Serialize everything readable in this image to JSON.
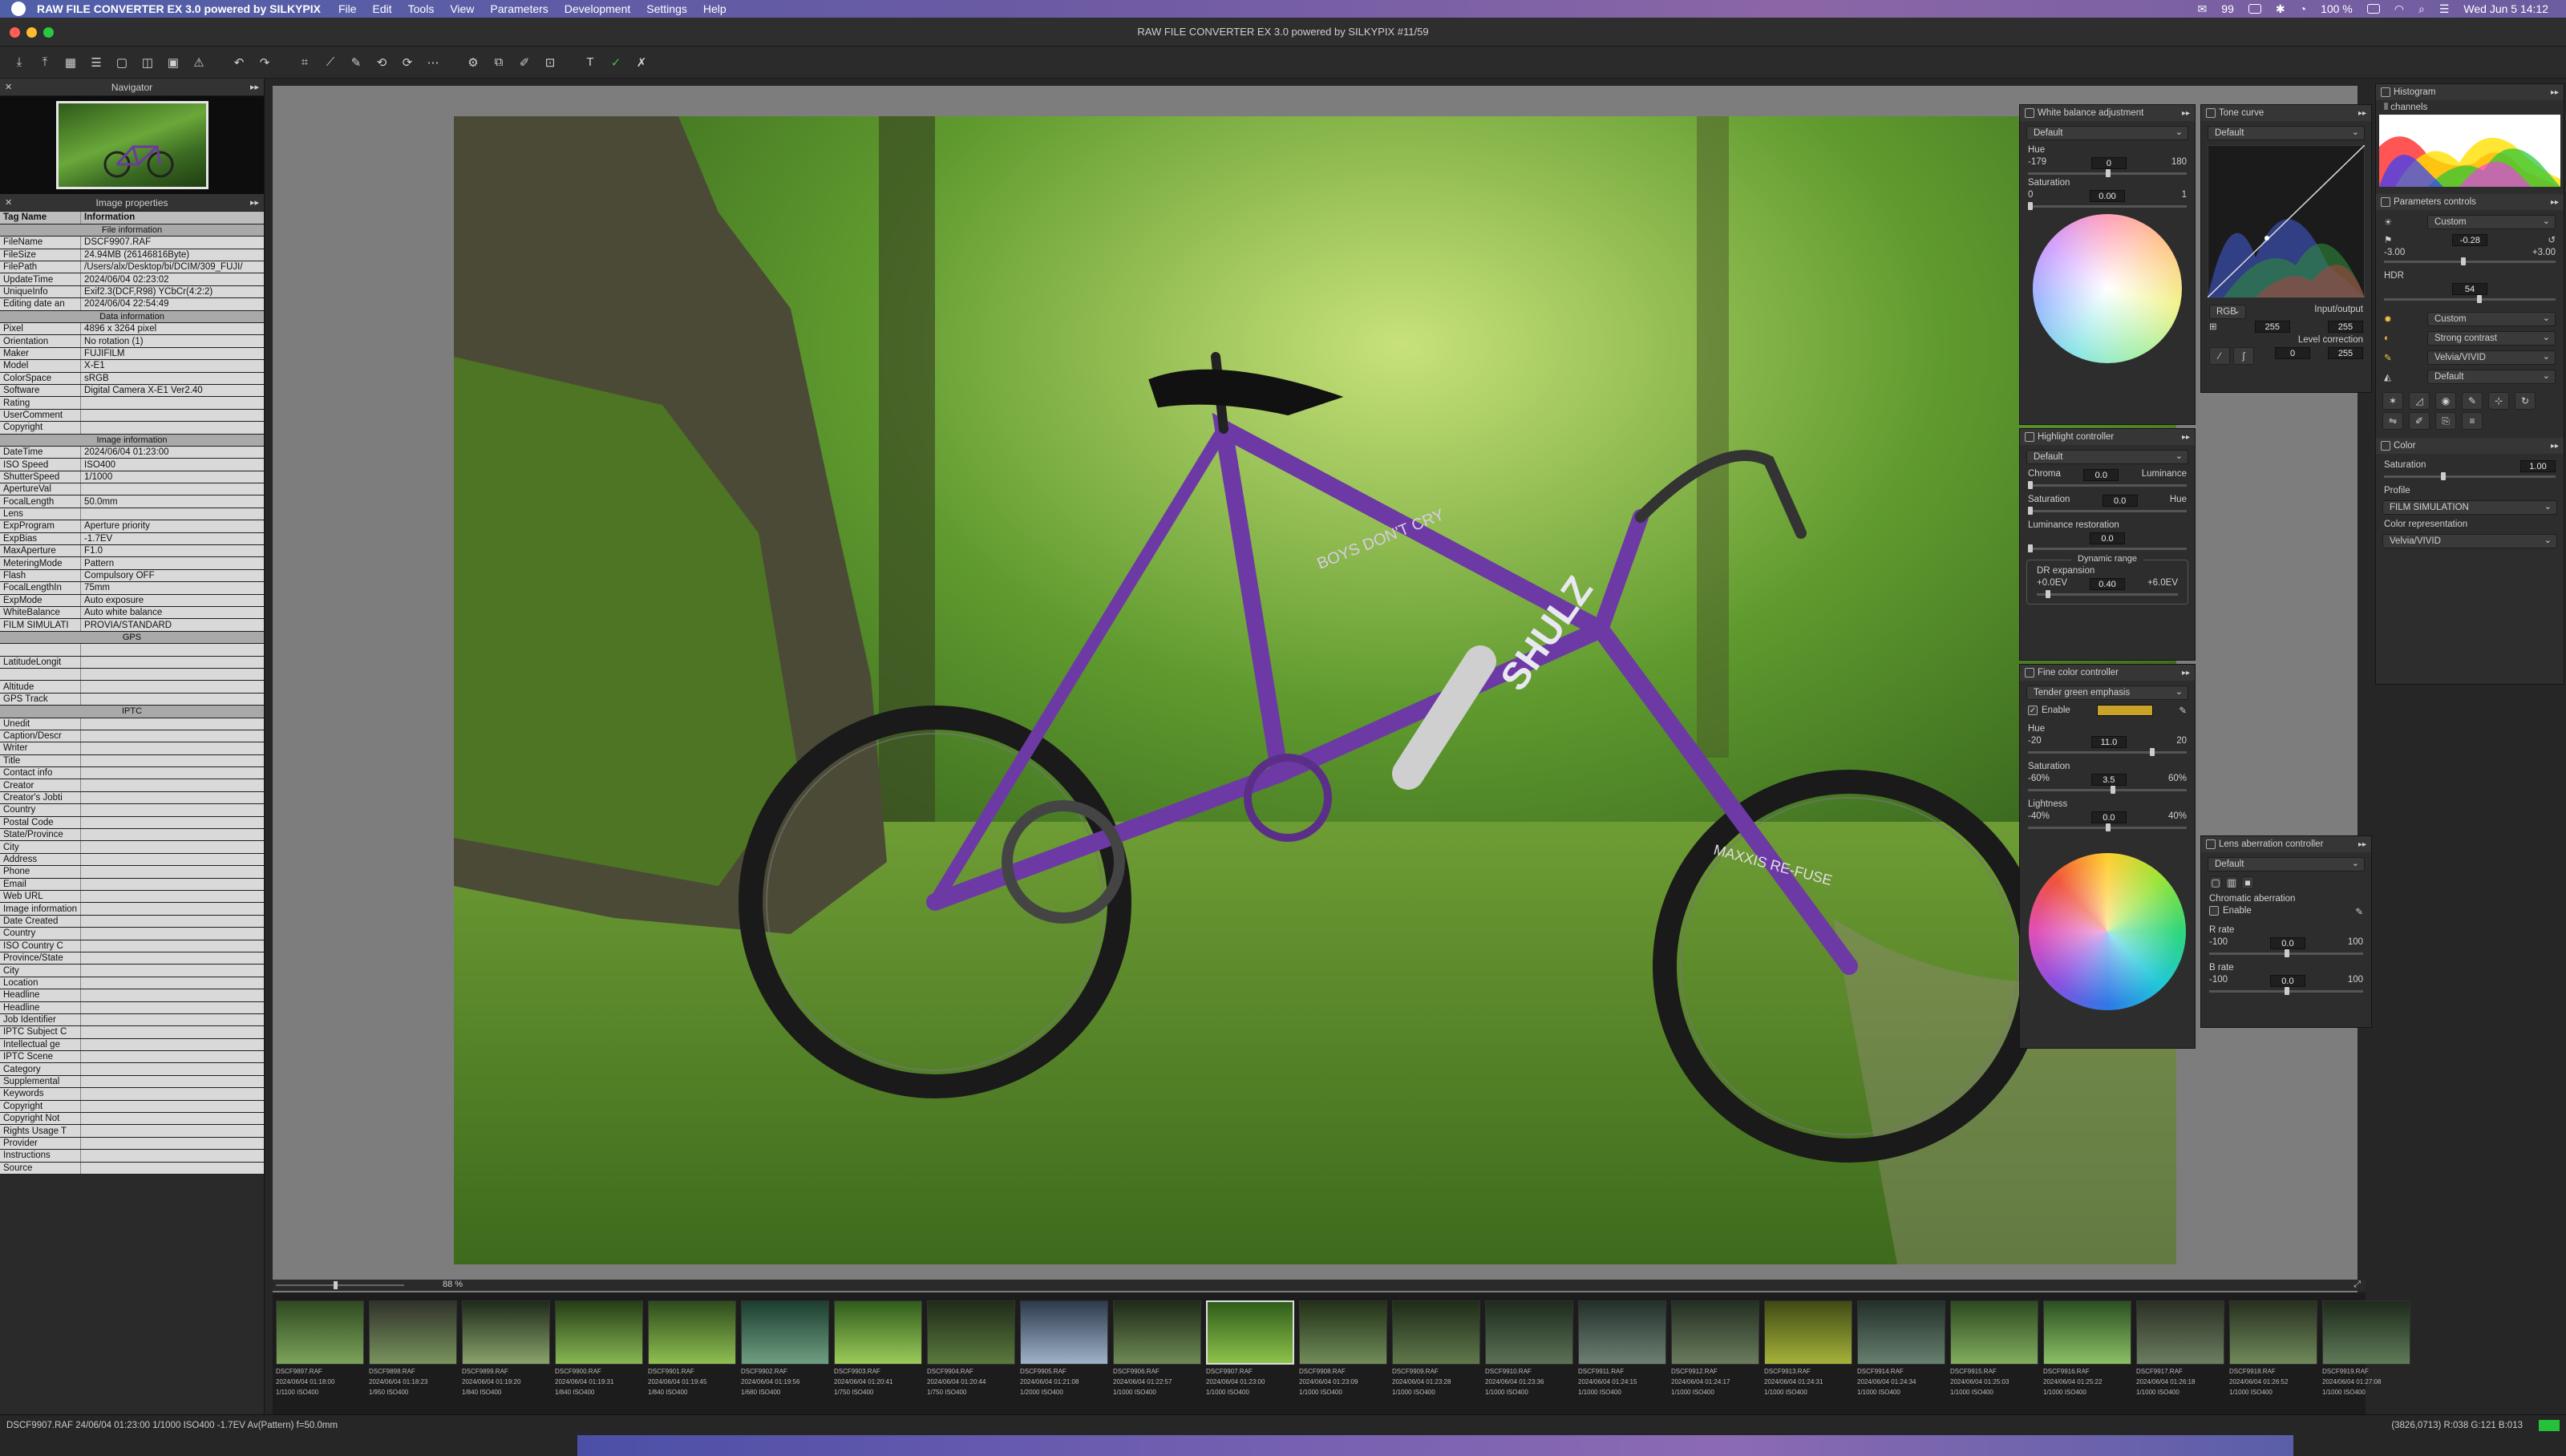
{
  "menubar": {
    "app": "RAW FILE CONVERTER EX 3.0 powered by SILKYPIX",
    "items": [
      "File",
      "Edit",
      "Tools",
      "View",
      "Parameters",
      "Development",
      "Settings",
      "Help"
    ],
    "battery": "100 %",
    "clock": "Wed Jun 5  14:12",
    "badge_count": "99"
  },
  "window": {
    "title": "RAW FILE CONVERTER EX 3.0 powered by SILKYPIX  #11/59"
  },
  "toolbar": {
    "icons": [
      "open-icon",
      "save-icon",
      "grid-view-icon",
      "list-view-icon",
      "single-view-icon",
      "compare-icon",
      "fullscreen-icon",
      "warning-icon",
      "undo-icon",
      "redo-icon",
      "crop-icon",
      "straighten-icon",
      "spot-icon",
      "rotate-left-icon",
      "rotate-right-icon",
      "dust-icon",
      "develop-icon",
      "batch-icon",
      "brush-icon",
      "overlay-icon",
      "text-icon",
      "approve-icon",
      "reject-icon"
    ]
  },
  "navigator": {
    "title": "Navigator"
  },
  "image_properties": {
    "title": "Image properties",
    "col_tag": "Tag Name",
    "col_info": "Information",
    "rows": [
      {
        "section": "File information"
      },
      {
        "k": "FileName",
        "v": "DSCF9907.RAF"
      },
      {
        "k": "FileSize",
        "v": "24.94MB (26146816Byte)"
      },
      {
        "k": "FilePath",
        "v": "/Users/alx/Desktop/bi/DCIM/309_FUJI/"
      },
      {
        "k": "UpdateTime",
        "v": "2024/06/04 02:23:02"
      },
      {
        "k": "UniqueInfo",
        "v": "Exif2.3(DCF,R98) YCbCr(4:2:2)"
      },
      {
        "k": "Editing date an",
        "v": "2024/06/04 22:54:49"
      },
      {
        "section": "Data information"
      },
      {
        "k": "Pixel",
        "v": "4896 x 3264 pixel"
      },
      {
        "k": "Orientation",
        "v": "No rotation (1)"
      },
      {
        "k": "Maker",
        "v": "FUJIFILM"
      },
      {
        "k": "Model",
        "v": "X-E1"
      },
      {
        "k": "ColorSpace",
        "v": "sRGB"
      },
      {
        "k": "Software",
        "v": "Digital Camera X-E1 Ver2.40"
      },
      {
        "k": "Rating",
        "v": ""
      },
      {
        "k": "UserComment",
        "v": ""
      },
      {
        "k": "Copyright",
        "v": ""
      },
      {
        "section": "Image information"
      },
      {
        "k": "DateTime",
        "v": "2024/06/04 01:23:00"
      },
      {
        "k": "ISO Speed",
        "v": "ISO400"
      },
      {
        "k": "ShutterSpeed",
        "v": "1/1000"
      },
      {
        "k": "ApertureVal",
        "v": ""
      },
      {
        "k": "FocalLength",
        "v": "50.0mm"
      },
      {
        "k": "Lens",
        "v": ""
      },
      {
        "k": "ExpProgram",
        "v": "Aperture priority"
      },
      {
        "k": "ExpBias",
        "v": "-1.7EV"
      },
      {
        "k": "MaxAperture",
        "v": "F1.0"
      },
      {
        "k": "MeteringMode",
        "v": "Pattern"
      },
      {
        "k": "Flash",
        "v": "Compulsory OFF"
      },
      {
        "k": "FocalLengthIn",
        "v": "75mm"
      },
      {
        "k": "ExpMode",
        "v": "Auto exposure"
      },
      {
        "k": "WhiteBalance",
        "v": "Auto white balance"
      },
      {
        "k": "FILM SIMULATI",
        "v": "PROVIA/STANDARD"
      },
      {
        "section": "GPS"
      },
      {
        "k": "",
        "v": ""
      },
      {
        "k": "LatitudeLongit",
        "v": ""
      },
      {
        "k": "",
        "v": ""
      },
      {
        "k": "Altitude",
        "v": ""
      },
      {
        "k": "GPS Track",
        "v": ""
      },
      {
        "section": "IPTC"
      },
      {
        "k": "Unedit",
        "v": ""
      },
      {
        "k": "Caption/Descr",
        "v": ""
      },
      {
        "k": "Writer",
        "v": ""
      },
      {
        "k": "Title",
        "v": ""
      },
      {
        "k": "Contact info",
        "v": ""
      },
      {
        "k": "Creator",
        "v": ""
      },
      {
        "k": "Creator's Jobti",
        "v": ""
      },
      {
        "k": "Country",
        "v": ""
      },
      {
        "k": "Postal Code",
        "v": ""
      },
      {
        "k": "State/Province",
        "v": ""
      },
      {
        "k": "City",
        "v": ""
      },
      {
        "k": "Address",
        "v": ""
      },
      {
        "k": "Phone",
        "v": ""
      },
      {
        "k": "Email",
        "v": ""
      },
      {
        "k": "Web URL",
        "v": ""
      },
      {
        "k": "Image information",
        "v": ""
      },
      {
        "k": "Date Created",
        "v": ""
      },
      {
        "k": "Country",
        "v": ""
      },
      {
        "k": "ISO Country C",
        "v": ""
      },
      {
        "k": "Province/State",
        "v": ""
      },
      {
        "k": "City",
        "v": ""
      },
      {
        "k": "Location",
        "v": ""
      },
      {
        "k": "Headline",
        "v": ""
      },
      {
        "k": "Headline",
        "v": ""
      },
      {
        "k": "Job Identifier",
        "v": ""
      },
      {
        "k": "IPTC Subject C",
        "v": ""
      },
      {
        "k": "Intellectual ge",
        "v": ""
      },
      {
        "k": "IPTC Scene",
        "v": ""
      },
      {
        "k": "Category",
        "v": ""
      },
      {
        "k": "Supplemental",
        "v": ""
      },
      {
        "k": "Keywords",
        "v": ""
      },
      {
        "k": "Copyright",
        "v": ""
      },
      {
        "k": "Copyright Not",
        "v": ""
      },
      {
        "k": "Rights Usage T",
        "v": ""
      },
      {
        "k": "Provider",
        "v": ""
      },
      {
        "k": "Instructions",
        "v": ""
      },
      {
        "k": "Source",
        "v": ""
      }
    ]
  },
  "viewer": {
    "zoom": "88 %"
  },
  "photo_text": {
    "frame_brand": "SHULZ",
    "top_tube": "BOYS DON'T CRY",
    "tire": "MAXXIS RE-FUSE"
  },
  "white_balance": {
    "title": "White balance adjustment",
    "preset": "Default",
    "hue_label": "Hue",
    "hue_min": "-179",
    "hue_val": "0",
    "hue_max": "180",
    "sat_label": "Saturation",
    "sat_min": "0",
    "sat_val": "0.00",
    "sat_max": "1"
  },
  "tone_curve": {
    "title": "Tone curve",
    "preset": "Default",
    "channel": "RGB",
    "io_label": "Input/output",
    "in_val": "255",
    "out_val": "255",
    "level_label": "Level correction",
    "lvl_lo": "0",
    "lvl_hi": "255"
  },
  "highlight": {
    "title": "Highlight controller",
    "preset": "Default",
    "chroma_label": "Chroma",
    "chroma_val": "0.0",
    "lum_label": "Luminance",
    "sat_label": "Saturation",
    "sat_val": "0.0",
    "hue_label": "Hue",
    "lumrest_label": "Luminance restoration",
    "lumrest_val": "0.0",
    "dr_group": "Dynamic range",
    "dr_label": "DR expansion",
    "dr_min": "+0.0EV",
    "dr_val": "0.40",
    "dr_max": "+6.0EV"
  },
  "fine_color": {
    "title": "Fine color controller",
    "preset": "Tender green emphasis",
    "enable_label": "Enable",
    "swatch_color": "#c9a22a",
    "hue_label": "Hue",
    "hue_min": "-20",
    "hue_val": "11.0",
    "hue_max": "20",
    "sat_label": "Saturation",
    "sat_min": "-60%",
    "sat_val": "3.5",
    "sat_max": "60%",
    "light_label": "Lightness",
    "light_min": "-40%",
    "light_val": "0.0",
    "light_max": "40%"
  },
  "lens": {
    "title": "Lens aberration controller",
    "preset": "Default",
    "chrom_label": "Chromatic aberration",
    "enable_label": "Enable",
    "r_label": "R rate",
    "r_min": "-100",
    "r_val": "0.0",
    "r_max": "100",
    "b_label": "B rate",
    "b_min": "-100",
    "b_val": "0.0",
    "b_max": "100"
  },
  "histogram": {
    "title": "Histogram",
    "channels": "ll channels"
  },
  "param_controls": {
    "title": "Parameters controls",
    "preset": "Custom",
    "exp_val": "-0.28",
    "exp_min": "-3.00",
    "exp_max": "+3.00",
    "hdr_label": "HDR",
    "hdr_val": "54",
    "tone_preset": "Custom",
    "contrast_preset": "Strong contrast",
    "color_preset": "Velvia/VIVID",
    "sharp_preset": "Default"
  },
  "color_panel": {
    "title": "Color",
    "sat_label": "Saturation",
    "sat_val": "1.00",
    "profile_label": "Profile",
    "profile_value": "FILM SIMULATION",
    "rep_label": "Color representation",
    "rep_value": "Velvia/VIVID"
  },
  "filmstrip": [
    {
      "name": "DSCF9897.RAF",
      "meta": "2024/06/04 01:18:00",
      "exp": "1/1100 ISO400",
      "c1": "#2f4a20",
      "c2": "#7ba35a"
    },
    {
      "name": "DSCF9898.RAF",
      "meta": "2024/06/04 01:18:23",
      "exp": "1/950 ISO400",
      "c1": "#30322a",
      "c2": "#79945d"
    },
    {
      "name": "DSCF9899.RAF",
      "meta": "2024/06/04 01:19:20",
      "exp": "1/840 ISO400",
      "c1": "#1f2a1a",
      "c2": "#8aa36b"
    },
    {
      "name": "DSCF9900.RAF",
      "meta": "2024/06/04 01:19:31",
      "exp": "1/840 ISO400",
      "c1": "#243d16",
      "c2": "#87b853"
    },
    {
      "name": "DSCF9901.RAF",
      "meta": "2024/06/04 01:19:45",
      "exp": "1/840 ISO400",
      "c1": "#2d4a1b",
      "c2": "#8fbf51"
    },
    {
      "name": "DSCF9902.RAF",
      "meta": "2024/06/04 01:19:56",
      "exp": "1/680 ISO400",
      "c1": "#1c3d2f",
      "c2": "#6f9f82"
    },
    {
      "name": "DSCF9903.RAF",
      "meta": "2024/06/04 01:20:41",
      "exp": "1/750 ISO400",
      "c1": "#2f5b1b",
      "c2": "#9ccb5a"
    },
    {
      "name": "DSCF9904.RAF",
      "meta": "2024/06/04 01:20:44",
      "exp": "1/750 ISO400",
      "c1": "#202a1a",
      "c2": "#5a7a3c"
    },
    {
      "name": "DSCF9905.RAF",
      "meta": "2024/06/04 01:21:08",
      "exp": "1/2000 ISO400",
      "c1": "#2c3a4c",
      "c2": "#9fb2c8"
    },
    {
      "name": "DSCF9906.RAF",
      "meta": "2024/06/04 01:22:57",
      "exp": "1/1000 ISO400",
      "c1": "#1e2a18",
      "c2": "#6f8a55"
    },
    {
      "name": "DSCF9907.RAF",
      "meta": "2024/06/04 01:23:00",
      "exp": "1/1000 ISO400",
      "c1": "#2e5c1a",
      "c2": "#8ec24a"
    },
    {
      "name": "DSCF9908.RAF",
      "meta": "2024/06/04 01:23:09",
      "exp": "1/1000 ISO400",
      "c1": "#223018",
      "c2": "#728d5a"
    },
    {
      "name": "DSCF9909.RAF",
      "meta": "2024/06/04 01:23:28",
      "exp": "1/1000 ISO400",
      "c1": "#1f2b18",
      "c2": "#60784c"
    },
    {
      "name": "DSCF9910.RAF",
      "meta": "2024/06/04 01:23:36",
      "exp": "1/1000 ISO400",
      "c1": "#1e2a1e",
      "c2": "#5b7256"
    },
    {
      "name": "DSCF9911.RAF",
      "meta": "2024/06/04 01:24:15",
      "exp": "1/1000 ISO400",
      "c1": "#23302a",
      "c2": "#6d8073"
    },
    {
      "name": "DSCF9912.RAF",
      "meta": "2024/06/04 01:24:17",
      "exp": "1/1000 ISO400",
      "c1": "#232e22",
      "c2": "#6a7c5c"
    },
    {
      "name": "DSCF9913.RAF",
      "meta": "2024/06/04 01:24:31",
      "exp": "1/1000 ISO400",
      "c1": "#3f4a14",
      "c2": "#a6b23a"
    },
    {
      "name": "DSCF9914.RAF",
      "meta": "2024/06/04 01:24:34",
      "exp": "1/1000 ISO400",
      "c1": "#23302a",
      "c2": "#66806e"
    },
    {
      "name": "DSCF9915.RAF",
      "meta": "2024/06/04 01:25:03",
      "exp": "1/1000 ISO400",
      "c1": "#2c4a20",
      "c2": "#82ad5e"
    },
    {
      "name": "DSCF9916.RAF",
      "meta": "2024/06/04 01:25:22",
      "exp": "1/1000 ISO400",
      "c1": "#2b4f22",
      "c2": "#8bc065"
    },
    {
      "name": "DSCF9917.RAF",
      "meta": "2024/06/04 01:26:18",
      "exp": "1/1000 ISO400",
      "c1": "#2a3024",
      "c2": "#6c7d60"
    },
    {
      "name": "DSCF9918.RAF",
      "meta": "2024/06/04 01:26:52",
      "exp": "1/1000 ISO400",
      "c1": "#27301f",
      "c2": "#708a5a"
    },
    {
      "name": "DSCF9919.RAF",
      "meta": "2024/06/04 01:27:08",
      "exp": "1/1000 ISO400",
      "c1": "#1f2a1c",
      "c2": "#5e7b58"
    }
  ],
  "selected_index": 10,
  "status": {
    "info": "DSCF9907.RAF 24/06/04 01:23:00 1/1000 ISO400 -1.7EV Av(Pattern) f=50.0mm",
    "coord": "(3826,0713) R:038 G:121 B:013"
  }
}
